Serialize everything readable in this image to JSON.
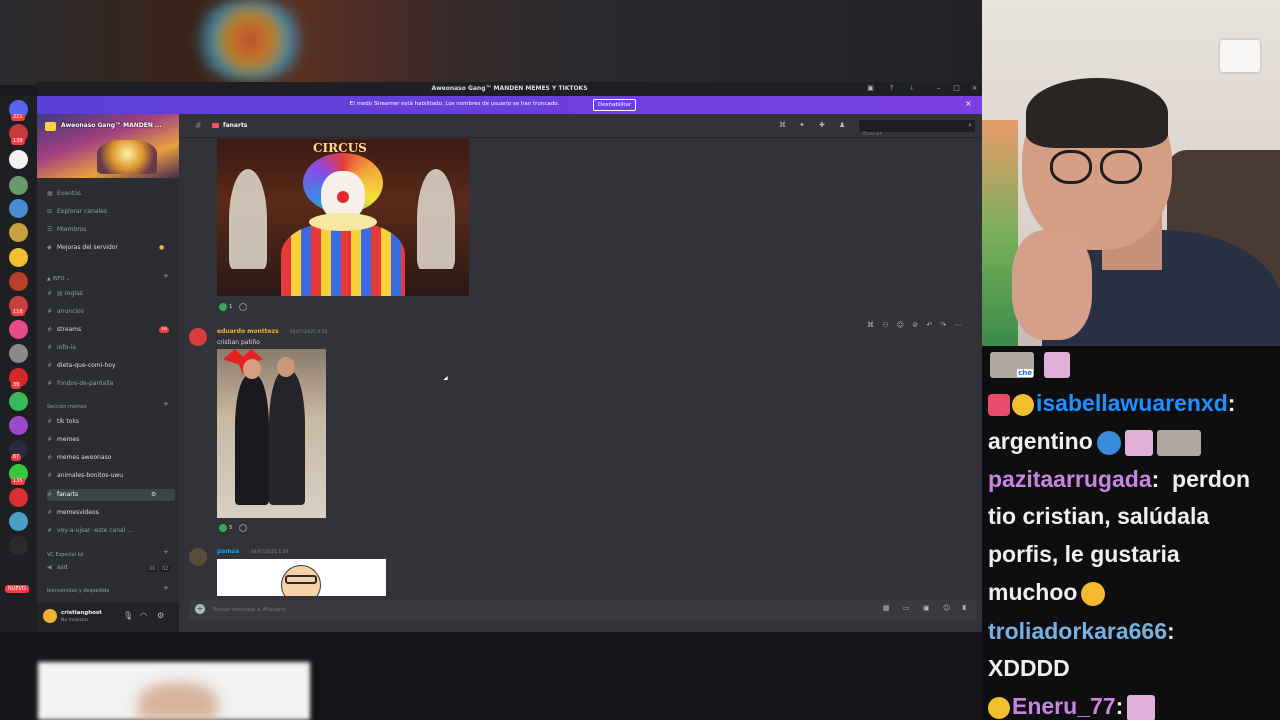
{
  "window": {
    "title": "Aweonaso Gang™ MANDEN MEMES Y TIKTOKS"
  },
  "banner": {
    "message": "El modo Streamer está habilitado. Los nombres de usuario se han truncado.",
    "button_label": "Deshabilitar"
  },
  "server_rail": {
    "badges": [
      "221",
      "139",
      "118",
      "39",
      "67",
      "135"
    ],
    "new_label": "NUEVO"
  },
  "guild": {
    "name": "Aweonaso Gang™ MANDEN ..."
  },
  "sidebar": {
    "top_items": [
      {
        "label": "Eventos",
        "icon": "calendar-icon"
      },
      {
        "label": "Explorar canales",
        "icon": "compass-icon"
      },
      {
        "label": "Miembros",
        "icon": "members-icon"
      },
      {
        "label": "Mejoras del servidor",
        "icon": "boost-icon"
      }
    ],
    "category_info": "INFO",
    "info_channels": [
      {
        "label": "reglas"
      },
      {
        "label": "anuncios"
      },
      {
        "label": "streams",
        "badge": "18"
      },
      {
        "label": "info-ia"
      },
      {
        "label": "dieta-que-comi-hoy"
      },
      {
        "label": "fondos-de-pantalla"
      }
    ],
    "category_memes": "Sección memes",
    "meme_channels": [
      {
        "label": "tik toks"
      },
      {
        "label": "memes"
      },
      {
        "label": "memes aweonaso"
      },
      {
        "label": "animales-bonitos-uwu"
      },
      {
        "label": "fanarts"
      },
      {
        "label": "memesvideos"
      },
      {
        "label": "voy-a-ujsar -este canal ..."
      }
    ],
    "category_vc": "VC Especial lol",
    "vc_channel": "asd",
    "vc_counts": [
      "00",
      "02"
    ],
    "category_welcome": "bienvenidas y despedida"
  },
  "user": {
    "name": "cristianghost",
    "status": "No molestar"
  },
  "channel": {
    "name": "fanarts",
    "search_placeholder": "Buscar"
  },
  "messages": [
    {
      "image": "circus-clown-image",
      "image_sign": "CIRCUS",
      "reaction_count": "1"
    },
    {
      "author": "eduardo monttezs",
      "author_color": "#f0b232",
      "timestamp": "04/07/2025 0:50",
      "text": "cristian patiño",
      "reaction_count": "5"
    },
    {
      "author": "pamsa",
      "author_color": "#00a8fc",
      "timestamp": "04/07/2025 1:29"
    }
  ],
  "composer": {
    "placeholder": "Enviar mensaje a #fanarts"
  },
  "chat": {
    "emote_labels": [
      "che"
    ],
    "lines": [
      {
        "user": "isabellawuarenxd",
        "color": "#1e90ff",
        "text": "argentino"
      },
      {
        "user": "pazitaarrugada",
        "color": "#c586e0",
        "text": "perdon tio cristian, salúdala porfis, le gustaria muchoo"
      },
      {
        "user": "troliadorkara666",
        "color": "#7ab0e0",
        "text": "XDDDD"
      },
      {
        "user": "Eneru_77",
        "color": "#c586e0",
        "text": ""
      }
    ]
  }
}
